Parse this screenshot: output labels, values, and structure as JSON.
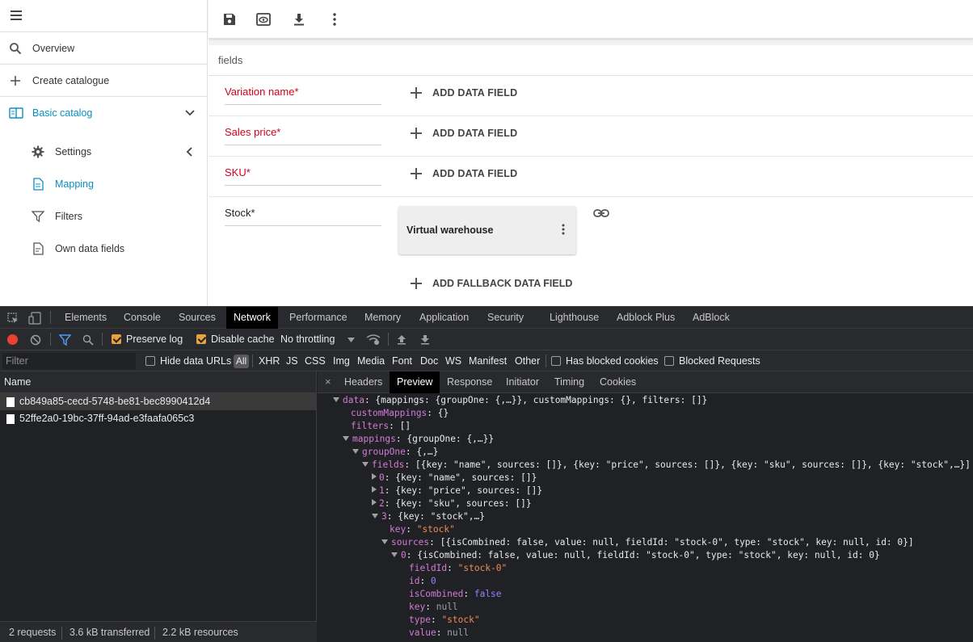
{
  "sidebar": {
    "items": [
      {
        "label": "Overview",
        "icon": "search-icon"
      },
      {
        "label": "Create catalogue",
        "icon": "plus-icon"
      },
      {
        "label": "Basic catalog",
        "icon": "book-icon"
      },
      {
        "label": "Settings",
        "icon": "gear-icon"
      },
      {
        "label": "Mapping",
        "icon": "document-icon"
      },
      {
        "label": "Filters",
        "icon": "filter-icon"
      },
      {
        "label": "Own data fields",
        "icon": "document-edit-icon"
      }
    ]
  },
  "main": {
    "section_title": "fields",
    "fields": [
      {
        "name": "Variation name*",
        "action": "ADD DATA FIELD"
      },
      {
        "name": "Sales price*",
        "action": "ADD DATA FIELD"
      },
      {
        "name": "SKU*",
        "action": "ADD DATA FIELD"
      }
    ],
    "stock": {
      "name": "Stock*",
      "card_title": "Virtual warehouse",
      "fallback": "ADD FALLBACK DATA FIELD"
    }
  },
  "devtools": {
    "tabs": [
      "Elements",
      "Console",
      "Sources",
      "Network",
      "Performance",
      "Memory",
      "Application",
      "Security",
      "Lighthouse",
      "Adblock Plus",
      "AdBlock"
    ],
    "active_tab": "Network",
    "toolbar": {
      "preserve_log": "Preserve log",
      "disable_cache": "Disable cache",
      "throttling": "No throttling"
    },
    "filter": {
      "placeholder": "Filter",
      "hide_data_urls": "Hide data URLs",
      "all": "All",
      "types": [
        "XHR",
        "JS",
        "CSS",
        "Img",
        "Media",
        "Font",
        "Doc",
        "WS",
        "Manifest",
        "Other"
      ],
      "has_blocked_cookies": "Has blocked cookies",
      "blocked_requests": "Blocked Requests"
    },
    "name_header": "Name",
    "requests": [
      "cb849a85-cecd-5748-be81-bec8990412d4",
      "52ffe2a0-19bc-37ff-94ad-e3faafa065c3"
    ],
    "status": {
      "requests": "2 requests",
      "transferred": "3.6 kB transferred",
      "resources": "2.2 kB resources"
    },
    "detail_tabs": [
      "Headers",
      "Preview",
      "Response",
      "Initiator",
      "Timing",
      "Cookies"
    ],
    "active_detail_tab": "Preview"
  }
}
